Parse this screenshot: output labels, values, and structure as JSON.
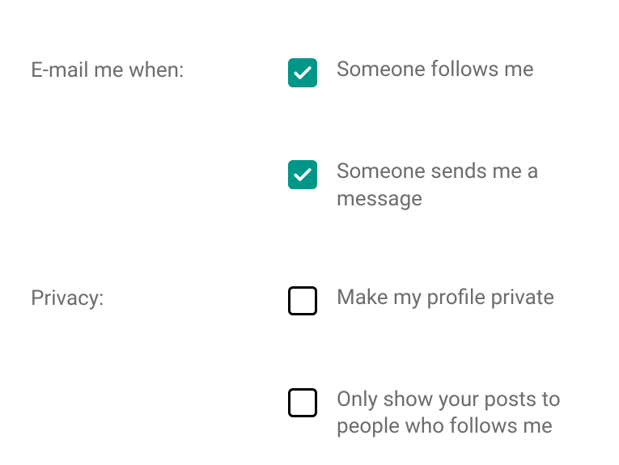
{
  "sections": {
    "email": {
      "label": "E-mail me when:",
      "options": [
        {
          "label": "Someone follows me",
          "checked": true
        },
        {
          "label": "Someone sends me a message",
          "checked": true
        }
      ]
    },
    "privacy": {
      "label": "Privacy:",
      "options": [
        {
          "label": "Make my profile private",
          "checked": false
        },
        {
          "label": "Only show your posts to people who follows me",
          "checked": false
        }
      ]
    }
  },
  "colors": {
    "checkboxChecked": "#009688",
    "text": "#6d6d6d"
  }
}
